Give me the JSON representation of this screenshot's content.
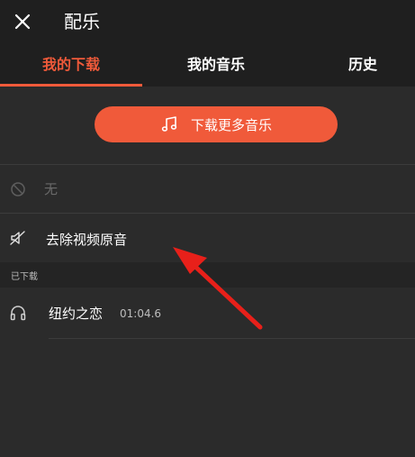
{
  "header": {
    "title": "配乐",
    "close_icon": "close-icon"
  },
  "tabs": [
    {
      "label": "我的下载",
      "active": true
    },
    {
      "label": "我的音乐",
      "active": false
    },
    {
      "label": "历史",
      "active": false
    }
  ],
  "download_more": {
    "label": "下载更多音乐",
    "icon": "music-note-icon"
  },
  "options": {
    "none_label": "无",
    "remove_original_label": "去除视频原音"
  },
  "downloaded": {
    "section_title": "已下载",
    "tracks": [
      {
        "title": "纽约之恋",
        "duration": "01:04.6"
      }
    ]
  },
  "colors": {
    "accent": "#f05a3a",
    "background": "#2b2b2b",
    "header": "#1f1f1f",
    "annotation_arrow": "#e8201a"
  }
}
